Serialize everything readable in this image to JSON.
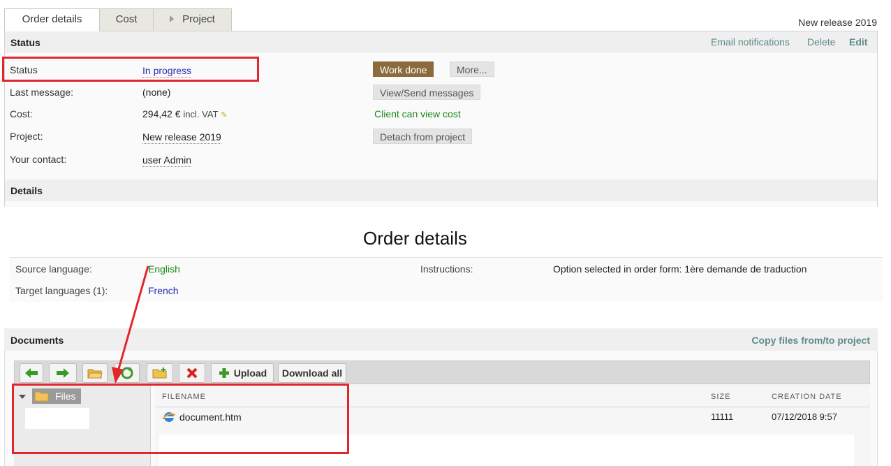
{
  "tabs": [
    {
      "label": "Order details"
    },
    {
      "label": "Cost"
    },
    {
      "label": "Project"
    }
  ],
  "header_project": "New release 2019",
  "status_section": {
    "title": "Status",
    "links": {
      "email": "Email notifications",
      "delete": "Delete",
      "edit": "Edit"
    },
    "rows": {
      "status": {
        "label": "Status",
        "value": "In progress"
      },
      "last_message": {
        "label": "Last message:",
        "value": "(none)"
      },
      "cost": {
        "label": "Cost:",
        "value": "294,42 €",
        "suffix": "incl. VAT"
      },
      "project": {
        "label": "Project:",
        "value": "New release 2019"
      },
      "contact": {
        "label": "Your contact:",
        "value": "user Admin"
      }
    },
    "buttons": {
      "work_done": "Work done",
      "more": "More...",
      "view_send": "View/Send messages",
      "detach": "Detach from project"
    },
    "client_note": "Client can view cost"
  },
  "details_section": {
    "title": "Details"
  },
  "big_title": "Order details",
  "details": {
    "source_label": "Source language:",
    "source_value": "English",
    "target_label": "Target languages (1):",
    "target_value": "French",
    "instructions_label": "Instructions:",
    "instructions_value": "Option selected in order form: 1ère demande de traduction"
  },
  "documents": {
    "title": "Documents",
    "copy_link": "Copy files from/to project",
    "toolbar": {
      "upload": "Upload",
      "download_all": "Download all"
    },
    "tree_root": "Files",
    "columns": {
      "filename": "FILENAME",
      "size": "SIZE",
      "date": "CREATION DATE"
    },
    "files": [
      {
        "name": "document.htm",
        "size": "11111",
        "date": "07/12/2018 9:57"
      }
    ]
  },
  "colors": {
    "accent_link": "#5d8a88",
    "work_done": "#8b6b3e",
    "highlight": "#e3262c",
    "client_note": "#1a8a1a"
  }
}
